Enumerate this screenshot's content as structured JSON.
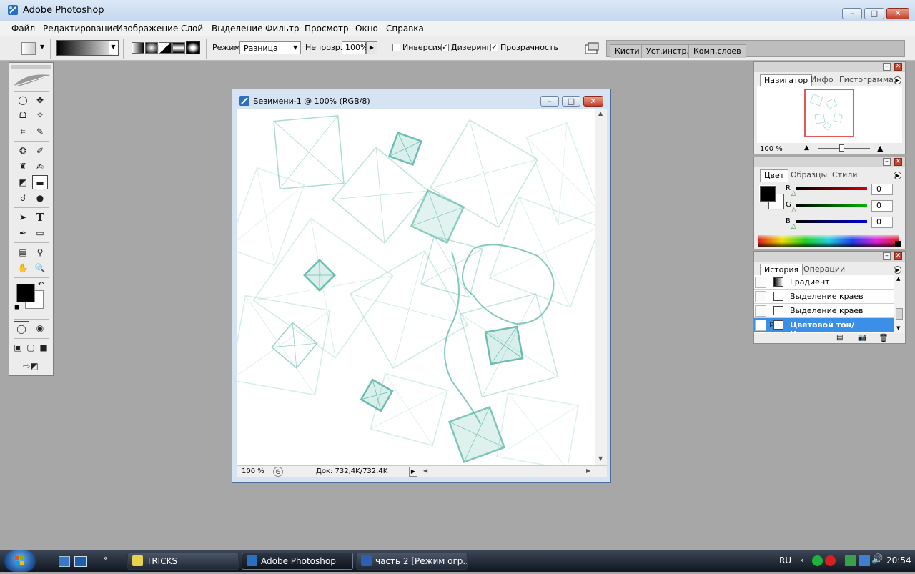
{
  "app": {
    "title": "Adobe Photoshop"
  },
  "window_controls": {
    "minimize": "–",
    "maximize": "□",
    "close": "✕"
  },
  "menu": [
    "Файл",
    "Редактирование",
    "Изображение",
    "Слой",
    "Выделение",
    "Фильтр",
    "Просмотр",
    "Окно",
    "Справка"
  ],
  "options": {
    "mode_label": "Режим:",
    "mode_value": "Разница",
    "opacity_label": "Непрозр.:",
    "opacity_value": "100%",
    "reverse_label": "Инверсия",
    "dither_label": "Дизеринг",
    "transparency_label": "Прозрачность",
    "reverse_checked": false,
    "dither_checked": true,
    "transparency_checked": true,
    "well_tabs": [
      "Кисти",
      "Уст.инстр.",
      "Комп.слоев"
    ]
  },
  "document": {
    "title": "Безимени-1 @ 100% (RGB/8)",
    "zoom": "100 %",
    "doc_info": "Док: 732,4K/732,4K",
    "accent_color": "#5cb8a9"
  },
  "navigator": {
    "tabs": [
      "Навигатор",
      "Инфо",
      "Гистограмма"
    ],
    "zoom": "100 %",
    "zoom_level": 0.45
  },
  "color_panel": {
    "tabs": [
      "Цвет",
      "Образцы",
      "Стили"
    ],
    "sliders": [
      {
        "channel": "R",
        "value": "0",
        "color": "#d40000"
      },
      {
        "channel": "G",
        "value": "0",
        "color": "#00b400"
      },
      {
        "channel": "B",
        "value": "0",
        "color": "#0000d4"
      }
    ],
    "foreground": "#000000",
    "background": "#ffffff"
  },
  "history": {
    "tabs": [
      "История",
      "Операции"
    ],
    "items": [
      {
        "label": "Градиент",
        "selected": false
      },
      {
        "label": "Выделение краев",
        "selected": false
      },
      {
        "label": "Выделение краев",
        "selected": false
      },
      {
        "label": "Цветовой тон/Насыщ...",
        "selected": true
      }
    ]
  },
  "taskbar": {
    "buttons": [
      {
        "label": "TRICKS",
        "active": false
      },
      {
        "label": "Adobe Photoshop",
        "active": true
      },
      {
        "label": "часть 2 [Режим огр...",
        "active": false
      }
    ],
    "language": "RU",
    "time": "20:54"
  }
}
